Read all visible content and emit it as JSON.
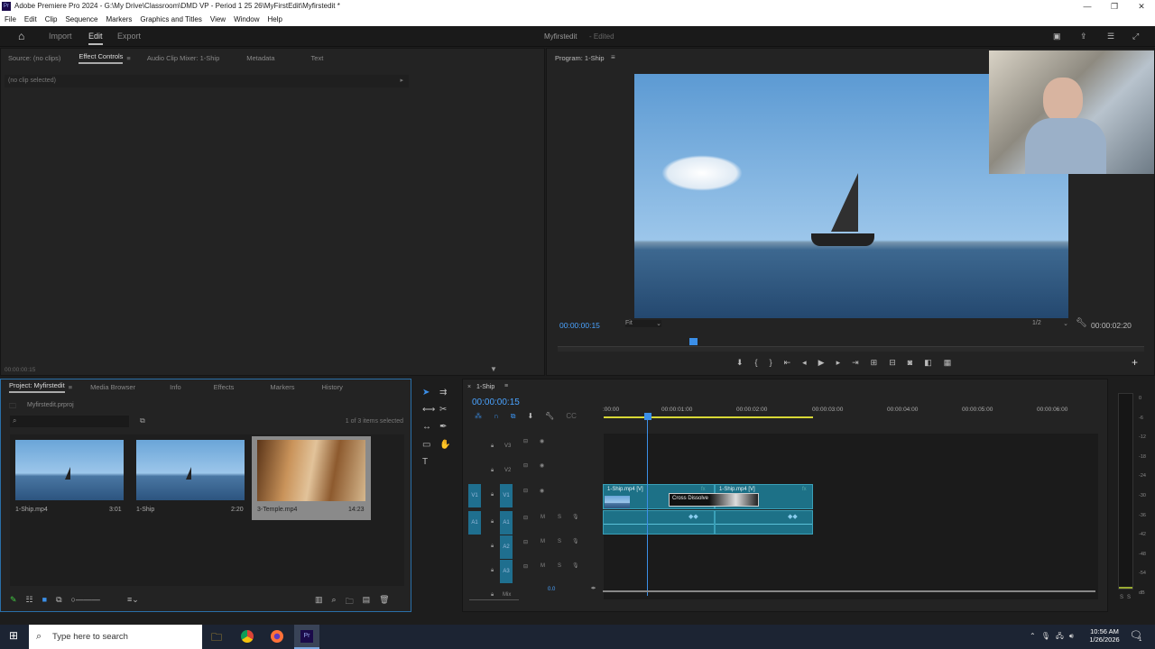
{
  "window": {
    "title": "Adobe Premiere Pro 2024 - G:\\My Drive\\Classroom\\DMD VP - Period 1 25 26\\MyFirstEdit\\Myfirstedit *",
    "app_badge": "Pr",
    "controls": [
      "—",
      "❐",
      "✕"
    ]
  },
  "menu": [
    "File",
    "Edit",
    "Clip",
    "Sequence",
    "Markers",
    "Graphics and Titles",
    "View",
    "Window",
    "Help"
  ],
  "header": {
    "tabs": [
      "Import",
      "Edit",
      "Export"
    ],
    "active": "Edit",
    "project_name": "Myfirstedit",
    "status": "- Edited"
  },
  "source_panel": {
    "tabs": [
      "Source: (no clips)",
      "Effect Controls",
      "Audio Clip Mixer: 1-Ship",
      "Metadata",
      "Text"
    ],
    "active": "Effect Controls",
    "no_clip": "(no clip selected)",
    "timecode": "00:00:00:15"
  },
  "program": {
    "title": "Program: 1-Ship",
    "timecode": "00:00:00:15",
    "fit": "Fit",
    "resolution": "1/2",
    "duration": "00:00:02:20",
    "playhead_fraction": 0.23
  },
  "project": {
    "tabs": [
      "Project: Myfirstedit",
      "Media Browser",
      "Info",
      "Effects",
      "Markers",
      "History"
    ],
    "file": "Myfirstedit.prproj",
    "search_placeholder": "",
    "selection": "1 of 3 items selected",
    "items": [
      {
        "name": "1-Ship.mp4",
        "duration": "3:01"
      },
      {
        "name": "1-Ship",
        "duration": "2:20"
      },
      {
        "name": "3-Temple.mp4",
        "duration": "14:23",
        "selected": true
      }
    ]
  },
  "timeline": {
    "sequence": "1-Ship",
    "timecode": "00:00:00:15",
    "ruler": [
      ":00:00",
      "00:00:01:00",
      "00:00:02:00",
      "00:00:03:00",
      "00:00:04:00",
      "00:00:05:00",
      "00:00:06:00"
    ],
    "video_tracks": [
      "V3",
      "V2",
      "V1"
    ],
    "audio_tracks": [
      "A1",
      "A2",
      "A3"
    ],
    "source_v": "V1",
    "source_a": "A1",
    "mute": "M",
    "solo": "S",
    "mix_label": "Mix",
    "mix_value": "0.0",
    "clips": [
      {
        "label": "1-Ship.mp4 [V]",
        "fx": "fx"
      },
      {
        "label": "1-Ship.mp4 [V]",
        "fx": "fx"
      }
    ],
    "transition": "Cross Dissolve"
  },
  "meter": {
    "ticks": [
      "0",
      "-6",
      "-12",
      "-18",
      "-24",
      "-30",
      "-36",
      "-42",
      "-48",
      "-54",
      "dB"
    ],
    "solo": [
      "S",
      "S"
    ]
  },
  "taskbar": {
    "search_placeholder": "Type here to search",
    "time": "10:56 AM",
    "date": "1/26/2026",
    "notifications": "1"
  }
}
